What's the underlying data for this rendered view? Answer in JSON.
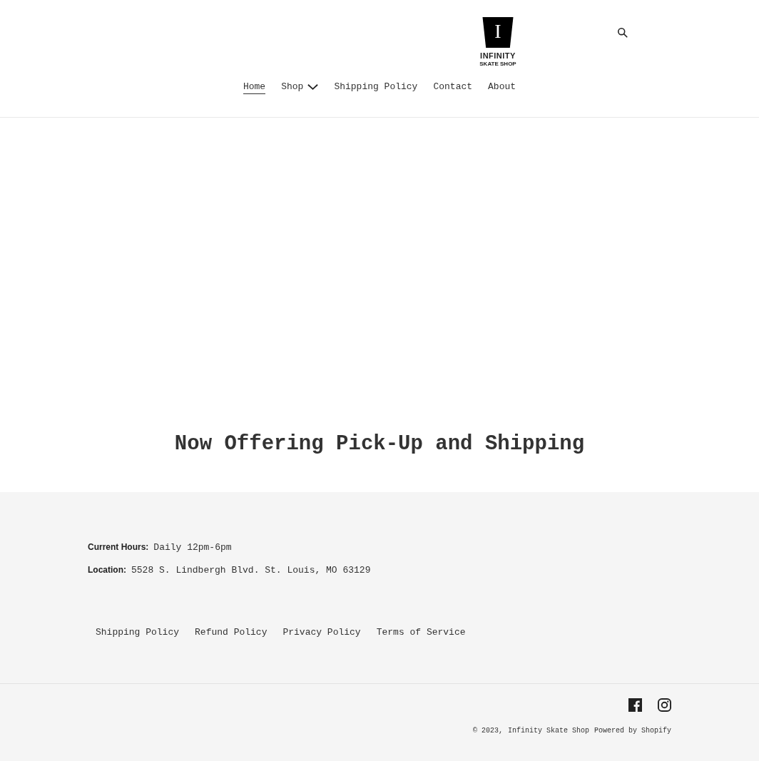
{
  "logo": {
    "letter": "I",
    "name": "INFINITY",
    "tagline": "SKATE SHOP"
  },
  "nav": [
    {
      "label": "Home",
      "selected": true,
      "dropdown": false
    },
    {
      "label": "Shop",
      "selected": false,
      "dropdown": true
    },
    {
      "label": "Shipping Policy",
      "selected": false,
      "dropdown": false
    },
    {
      "label": "Contact",
      "selected": false,
      "dropdown": false
    },
    {
      "label": "About",
      "selected": false,
      "dropdown": false
    }
  ],
  "heading": "Now Offering Pick-Up and Shipping",
  "info": [
    {
      "label": "Current Hours:",
      "value": "Daily 12pm-6pm"
    },
    {
      "label": "Location:",
      "value": "5528 S. Lindbergh Blvd. St. Louis, MO 63129"
    }
  ],
  "footer_links": [
    "Shipping Policy",
    "Refund Policy",
    "Privacy Policy",
    "Terms of Service"
  ],
  "social": [
    {
      "kind": "facebook"
    },
    {
      "kind": "instagram"
    }
  ],
  "copyright": {
    "prefix": "© 2023,",
    "shop": "Infinity Skate Shop",
    "powered": "Powered by Shopify"
  }
}
